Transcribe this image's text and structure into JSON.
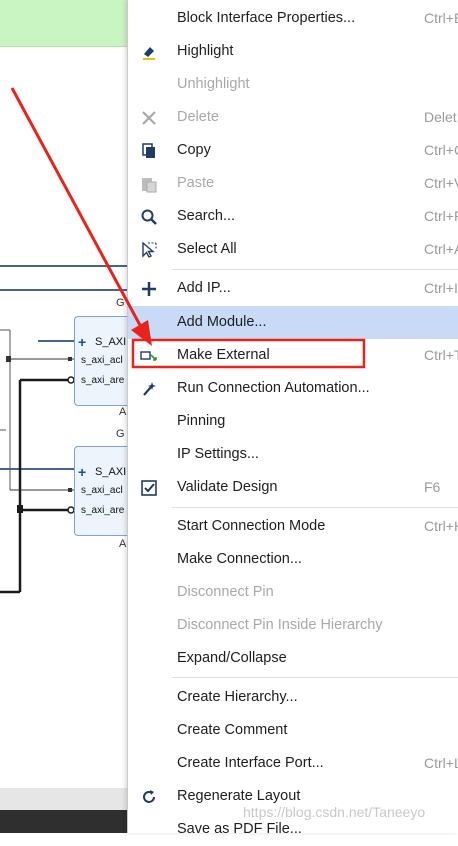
{
  "background": {
    "blocks": [
      {
        "title": "G",
        "port_main": "S_AXI",
        "port_aclk": "s_axi_acl",
        "port_aresetn": "s_axi_are",
        "footer": "A"
      },
      {
        "title": "G",
        "port_main": "S_AXI",
        "port_aclk": "s_axi_acl",
        "port_aresetn": "s_axi_are",
        "footer": "A"
      }
    ]
  },
  "menu": {
    "items": [
      {
        "label": "Block Interface Properties...",
        "shortcut": "Ctrl+E",
        "icon": "none",
        "disabled": false
      },
      {
        "label": "Highlight",
        "shortcut": "",
        "icon": "highlight-icon",
        "disabled": false
      },
      {
        "label": "Unhighlight",
        "shortcut": "",
        "icon": "none",
        "disabled": true
      },
      {
        "label": "Delete",
        "shortcut": "Delet",
        "icon": "delete-icon",
        "disabled": true
      },
      {
        "label": "Copy",
        "shortcut": "Ctrl+C",
        "icon": "copy-icon",
        "disabled": false
      },
      {
        "label": "Paste",
        "shortcut": "Ctrl+V",
        "icon": "paste-icon",
        "disabled": true
      },
      {
        "label": "Search...",
        "shortcut": "Ctrl+F",
        "icon": "search-icon",
        "disabled": false
      },
      {
        "label": "Select All",
        "shortcut": "Ctrl+A",
        "icon": "select-all-icon",
        "disabled": false
      },
      {
        "label": "Add IP...",
        "shortcut": "Ctrl+I",
        "icon": "add-icon",
        "disabled": false
      },
      {
        "label": "Add Module...",
        "shortcut": "",
        "icon": "none",
        "disabled": false,
        "highlighted": true
      },
      {
        "label": "Make External",
        "shortcut": "Ctrl+T",
        "icon": "make-external-icon",
        "disabled": false
      },
      {
        "label": "Run Connection Automation...",
        "shortcut": "",
        "icon": "wand-icon",
        "disabled": false
      },
      {
        "label": "Pinning",
        "shortcut": "",
        "icon": "none",
        "disabled": false
      },
      {
        "label": "IP Settings...",
        "shortcut": "",
        "icon": "none",
        "disabled": false
      },
      {
        "label": "Validate Design",
        "shortcut": "F6",
        "icon": "validate-icon",
        "disabled": false
      },
      {
        "label": "Start Connection Mode",
        "shortcut": "Ctrl+H",
        "icon": "none",
        "disabled": false
      },
      {
        "label": "Make Connection...",
        "shortcut": "",
        "icon": "none",
        "disabled": false
      },
      {
        "label": "Disconnect Pin",
        "shortcut": "",
        "icon": "none",
        "disabled": true
      },
      {
        "label": "Disconnect Pin Inside Hierarchy",
        "shortcut": "",
        "icon": "none",
        "disabled": true
      },
      {
        "label": "Expand/Collapse",
        "shortcut": "",
        "icon": "none",
        "disabled": false
      },
      {
        "label": "Create Hierarchy...",
        "shortcut": "",
        "icon": "none",
        "disabled": false
      },
      {
        "label": "Create Comment",
        "shortcut": "",
        "icon": "none",
        "disabled": false
      },
      {
        "label": "Create Interface Port...",
        "shortcut": "Ctrl+L",
        "icon": "none",
        "disabled": false
      },
      {
        "label": "Regenerate Layout",
        "shortcut": "",
        "icon": "refresh-icon",
        "disabled": false
      },
      {
        "label": "Save as PDF File...",
        "shortcut": "",
        "icon": "none",
        "disabled": false
      }
    ]
  },
  "watermark": "https://blog.csdn.net/Taneeyo",
  "colors": {
    "highlight_row": "#c8daf5",
    "annotation_red": "#e8231c",
    "disabled_text": "#a8a8a8"
  }
}
